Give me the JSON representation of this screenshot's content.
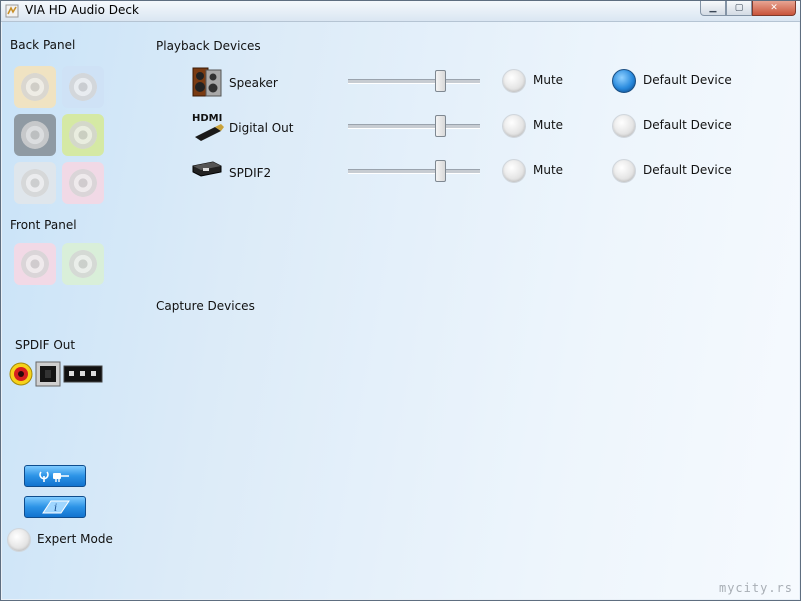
{
  "window": {
    "title": "VIA HD Audio Deck"
  },
  "left": {
    "back_panel": "Back Panel",
    "back_jacks": [
      {
        "color": "#f0e3c2"
      },
      {
        "color": "#cfe2f6"
      },
      {
        "color": "#8f9aa3"
      },
      {
        "color": "#d5e9a4"
      },
      {
        "color": "#dfe6ec"
      },
      {
        "color": "#f1d9e6"
      }
    ],
    "front_panel": "Front Panel",
    "front_jacks": [
      {
        "color": "#f2d9e6"
      },
      {
        "color": "#d9efd9"
      }
    ],
    "spdif_out": "SPDIF Out",
    "expert_mode": "Expert Mode"
  },
  "main": {
    "playback_title": "Playback Devices",
    "capture_title": "Capture Devices",
    "devices": [
      {
        "name": "Speaker",
        "icon": "speaker-icon",
        "volume": 0.72,
        "mute_label": "Mute",
        "muted": false,
        "default_label": "Default Device",
        "is_default": true
      },
      {
        "name": "Digital Out",
        "icon": "hdmi-icon",
        "icon_text": "HDMI",
        "volume": 0.72,
        "mute_label": "Mute",
        "muted": false,
        "default_label": "Default Device",
        "is_default": false
      },
      {
        "name": "SPDIF2",
        "icon": "spdif-icon",
        "volume": 0.72,
        "mute_label": "Mute",
        "muted": false,
        "default_label": "Default Device",
        "is_default": false
      }
    ]
  },
  "watermark": "mycity.rs"
}
